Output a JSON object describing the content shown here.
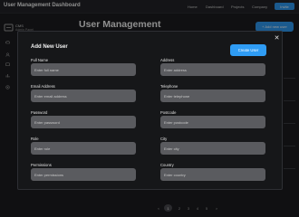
{
  "app": {
    "title": "User Management Dashboard"
  },
  "topnav": {
    "items": [
      "Home",
      "Dashboard",
      "Projects",
      "Company"
    ],
    "invite_label": "Invite"
  },
  "sidebar": {
    "brand_name": "CMS",
    "brand_sub": "Admin Panel",
    "icons": [
      "cloud-icon",
      "users-icon",
      "chat-icon",
      "chart-icon",
      "monitor-icon",
      "settings-icon"
    ]
  },
  "page": {
    "title": "User Management",
    "add_user_label": "+ Add new user"
  },
  "pagination": {
    "prev": "<",
    "pages": [
      "1",
      "2",
      "3",
      "4",
      "5"
    ],
    "current": "1",
    "next": ">"
  },
  "modal": {
    "title": "Add New User",
    "close_glyph": "✕",
    "create_label": "Create User",
    "fields": [
      {
        "label": "Full Name",
        "placeholder": "Enter full name",
        "value": ""
      },
      {
        "label": "Address",
        "placeholder": "Enter address",
        "value": ""
      },
      {
        "label": "Email Address",
        "placeholder": "Enter email address",
        "value": ""
      },
      {
        "label": "Telephone",
        "placeholder": "Enter telephone",
        "value": ""
      },
      {
        "label": "Password",
        "placeholder": "Enter password",
        "value": ""
      },
      {
        "label": "Postcode",
        "placeholder": "Enter postcode",
        "value": ""
      },
      {
        "label": "Role",
        "placeholder": "Enter role",
        "value": ""
      },
      {
        "label": "City",
        "placeholder": "Enter city",
        "value": ""
      },
      {
        "label": "Permissions",
        "placeholder": "Enter permissions",
        "value": ""
      },
      {
        "label": "Country",
        "placeholder": "Enter country",
        "value": ""
      }
    ]
  },
  "colors": {
    "accent": "#2f9cf4",
    "background": "#1c1d20",
    "modal_background": "#161719",
    "input_background": "#5a5b5f"
  }
}
